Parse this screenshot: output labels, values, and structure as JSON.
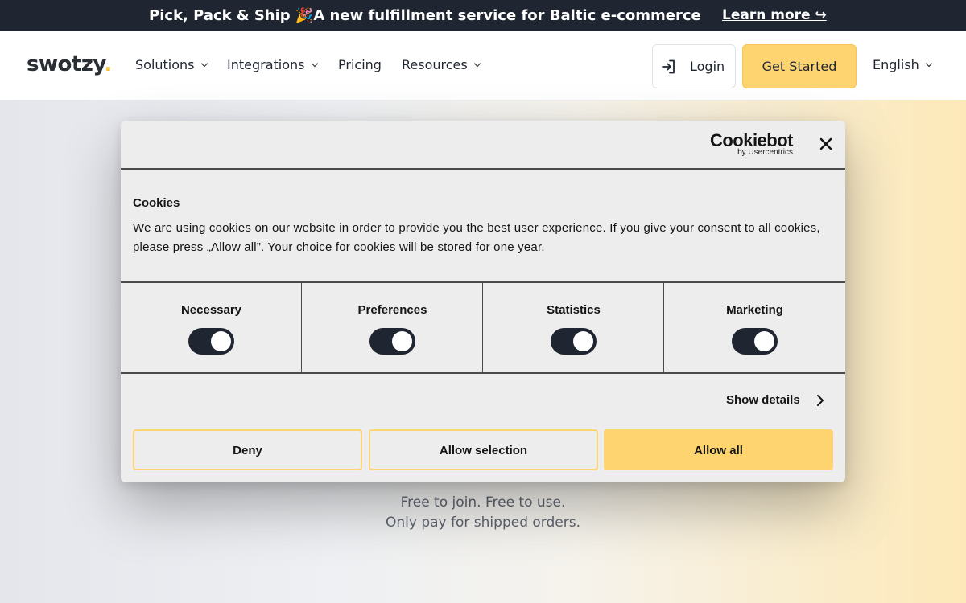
{
  "announcement": {
    "text": "Pick, Pack & Ship 🎉A new fulfillment service for Baltic e-commerce",
    "link": "Learn more ↪"
  },
  "nav": {
    "logo": "swotzy",
    "logo_dot": ".",
    "items": [
      "Solutions",
      "Integrations",
      "Pricing",
      "Resources"
    ],
    "login": "Login",
    "cta": "Get Started",
    "language": "English"
  },
  "hero": {
    "line1": "Free to join. Free to use.",
    "line2": "Only pay for shipped orders."
  },
  "cookie_dialog": {
    "brand": "Cookiebot",
    "brand_sub": "by Usercentrics",
    "heading": "Cookies",
    "text": "We are using cookies on our website in order to provide you the best user experience. If you give your consent to all cookies, please press „Allow all”.  Your choice for cookies will be stored for one year.",
    "categories": [
      {
        "label": "Necessary",
        "enabled": true
      },
      {
        "label": "Preferences",
        "enabled": true
      },
      {
        "label": "Statistics",
        "enabled": true
      },
      {
        "label": "Marketing",
        "enabled": true
      }
    ],
    "show_details": "Show details",
    "buttons": {
      "deny": "Deny",
      "allow_selection": "Allow selection",
      "allow_all": "Allow all"
    }
  },
  "colors": {
    "accent": "#fed470",
    "dark": "#1f2631"
  }
}
